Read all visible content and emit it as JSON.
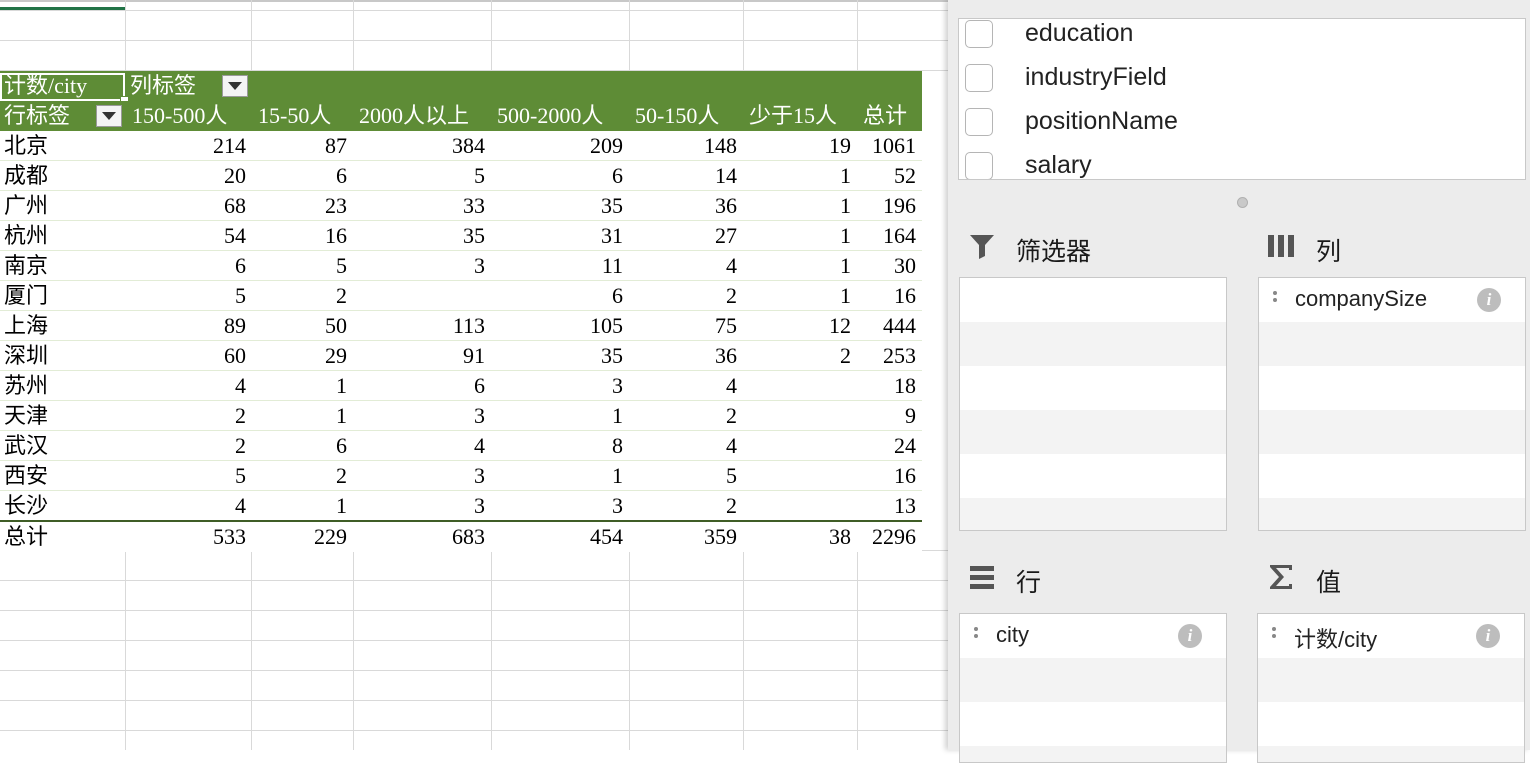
{
  "pivot": {
    "corner_label": "计数/city",
    "column_labels_caption": "列标签",
    "row_labels_caption": "行标签",
    "columns": [
      "150-500人",
      "15-50人",
      "2000人以上",
      "500-2000人",
      "50-150人",
      "少于15人",
      "总计"
    ],
    "rows": [
      {
        "city": "北京",
        "values": [
          "214",
          "87",
          "384",
          "209",
          "148",
          "19",
          "1061"
        ]
      },
      {
        "city": "成都",
        "values": [
          "20",
          "6",
          "5",
          "6",
          "14",
          "1",
          "52"
        ]
      },
      {
        "city": "广州",
        "values": [
          "68",
          "23",
          "33",
          "35",
          "36",
          "1",
          "196"
        ]
      },
      {
        "city": "杭州",
        "values": [
          "54",
          "16",
          "35",
          "31",
          "27",
          "1",
          "164"
        ]
      },
      {
        "city": "南京",
        "values": [
          "6",
          "5",
          "3",
          "11",
          "4",
          "1",
          "30"
        ]
      },
      {
        "city": "厦门",
        "values": [
          "5",
          "2",
          "",
          "6",
          "2",
          "1",
          "16"
        ]
      },
      {
        "city": "上海",
        "values": [
          "89",
          "50",
          "113",
          "105",
          "75",
          "12",
          "444"
        ]
      },
      {
        "city": "深圳",
        "values": [
          "60",
          "29",
          "91",
          "35",
          "36",
          "2",
          "253"
        ]
      },
      {
        "city": "苏州",
        "values": [
          "4",
          "1",
          "6",
          "3",
          "4",
          "",
          "18"
        ]
      },
      {
        "city": "天津",
        "values": [
          "2",
          "1",
          "3",
          "1",
          "2",
          "",
          "9"
        ]
      },
      {
        "city": "武汉",
        "values": [
          "2",
          "6",
          "4",
          "8",
          "4",
          "",
          "24"
        ]
      },
      {
        "city": "西安",
        "values": [
          "5",
          "2",
          "3",
          "1",
          "5",
          "",
          "16"
        ]
      },
      {
        "city": "长沙",
        "values": [
          "4",
          "1",
          "3",
          "3",
          "2",
          "",
          "13"
        ]
      }
    ],
    "total": {
      "label": "总计",
      "values": [
        "533",
        "229",
        "683",
        "454",
        "359",
        "38",
        "2296"
      ]
    }
  },
  "pane": {
    "fields": [
      {
        "name": "education",
        "checked": false
      },
      {
        "name": "industryField",
        "checked": false
      },
      {
        "name": "positionName",
        "checked": false
      },
      {
        "name": "salary",
        "checked": false
      }
    ],
    "areas": {
      "filters": {
        "title": "筛选器",
        "icon": "filter-funnel-icon",
        "items": []
      },
      "columns": {
        "title": "列",
        "icon": "columns-icon",
        "items": [
          "companySize"
        ]
      },
      "rows": {
        "title": "行",
        "icon": "rows-icon",
        "items": [
          "city"
        ]
      },
      "values": {
        "title": "值",
        "icon": "sigma-icon",
        "items": [
          "计数/city"
        ]
      }
    }
  },
  "colors": {
    "pivot_header": "#5e8c36",
    "pane_bg": "#ececec",
    "accent_green": "#217346"
  }
}
